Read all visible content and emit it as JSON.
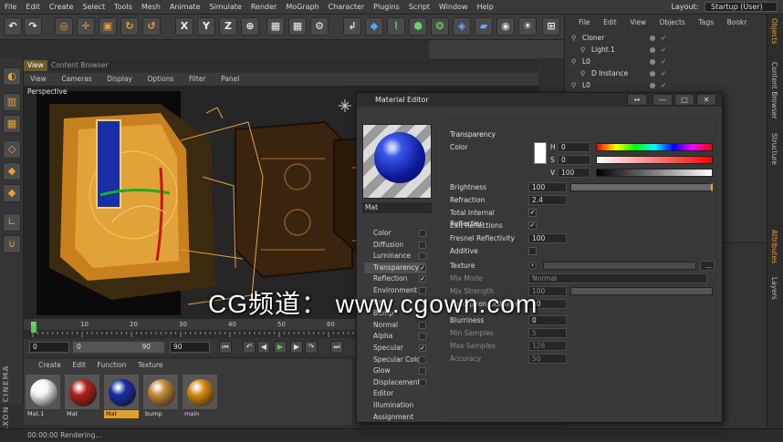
{
  "menubar": {
    "items": [
      "File",
      "Edit",
      "Create",
      "Select",
      "Tools",
      "Mesh",
      "Animate",
      "Simulate",
      "Render",
      "MoGraph",
      "Character",
      "Plugins",
      "Script",
      "Window",
      "Help"
    ],
    "layout_label": "Layout:",
    "layout_value": "Startup (User)"
  },
  "toolbar": {
    "axis_x": "X",
    "axis_y": "Y",
    "axis_z": "Z"
  },
  "view": {
    "tabs": [
      "View",
      "Content Browser"
    ],
    "menu": [
      "View",
      "Cameras",
      "Display",
      "Options",
      "Filter",
      "Panel"
    ],
    "label": "Perspective"
  },
  "timeline": {
    "ticks": [
      "0",
      "10",
      "20",
      "30",
      "40",
      "50",
      "60"
    ],
    "start": "0",
    "current": "0",
    "end_slider": "90",
    "end": "90"
  },
  "material_manager": {
    "menu": [
      "Create",
      "Edit",
      "Function",
      "Texture"
    ],
    "materials": [
      {
        "name": "Mat.1",
        "color": "#f5f5f5"
      },
      {
        "name": "Mat",
        "color": "#b3231a"
      },
      {
        "name": "Mat",
        "color": "#1a2ea8"
      },
      {
        "name": "bump",
        "color": "#c58a3a"
      },
      {
        "name": "main",
        "color": "#d88a10"
      }
    ]
  },
  "status": {
    "text": "00:00:00 Rendering..."
  },
  "brand": "MAXON CINEMA 4D",
  "object_manager": {
    "menu": [
      "File",
      "Edit",
      "View",
      "Objects",
      "Tags",
      "Bookr"
    ],
    "objects": [
      {
        "name": "Cloner",
        "indent": 0
      },
      {
        "name": "Light.1",
        "indent": 1
      },
      {
        "name": "L0",
        "indent": 0
      },
      {
        "name": "D Instance",
        "indent": 1
      },
      {
        "name": "L0",
        "indent": 0
      }
    ],
    "side_tabs": [
      "Objects",
      "Content Browser",
      "Structure",
      "Attributes",
      "Layers"
    ]
  },
  "material_editor": {
    "title": "Material Editor",
    "mat_name": "Mat",
    "channels": [
      {
        "label": "Color",
        "checked": false
      },
      {
        "label": "Diffusion",
        "checked": false
      },
      {
        "label": "Luminance",
        "checked": false
      },
      {
        "label": "Transparency",
        "checked": true
      },
      {
        "label": "Reflection",
        "checked": true
      },
      {
        "label": "Environment",
        "checked": false
      },
      {
        "label": "Fog",
        "checked": false
      },
      {
        "label": "Bump",
        "checked": false
      },
      {
        "label": "Normal",
        "checked": false
      },
      {
        "label": "Alpha",
        "checked": false
      },
      {
        "label": "Specular",
        "checked": true
      },
      {
        "label": "Specular Color",
        "checked": false
      },
      {
        "label": "Glow",
        "checked": false
      },
      {
        "label": "Displacement",
        "checked": false
      },
      {
        "label": "Editor",
        "checked": false
      },
      {
        "label": "Illumination",
        "checked": false
      },
      {
        "label": "Assignment",
        "checked": false
      }
    ],
    "section": "Transparency",
    "color_label": "Color",
    "hsv": [
      {
        "ch": "H",
        "val": "0"
      },
      {
        "ch": "S",
        "val": "0"
      },
      {
        "ch": "V",
        "val": "100"
      }
    ],
    "params": [
      {
        "label": "Brightness",
        "value": "100",
        "type": "slider",
        "fill": 1.0
      },
      {
        "label": "Refraction",
        "value": "2.4",
        "type": "value"
      },
      {
        "label": "Total Internal Reflection",
        "type": "check",
        "checked": true
      },
      {
        "label": "Exit Reflections",
        "type": "check",
        "checked": true
      },
      {
        "label": "Fresnel Reflectivity",
        "value": "100",
        "type": "value"
      },
      {
        "label": "Additive",
        "type": "check",
        "checked": false
      }
    ],
    "texture_label": "Texture",
    "mix_mode_label": "Mix Mode",
    "mix_mode_value": "Normal",
    "mix_strength_label": "Mix Strength",
    "mix_strength_value": "100",
    "absorption_label": "Absorption Distance",
    "absorption_value": "10",
    "blur": [
      {
        "label": "Blurriness",
        "value": "0",
        "dim": false
      },
      {
        "label": "Min Samples",
        "value": "5",
        "dim": true
      },
      {
        "label": "Max Samples",
        "value": "128",
        "dim": true
      },
      {
        "label": "Accuracy",
        "value": "50",
        "dim": true
      }
    ]
  },
  "watermark": "CG频道： www.cgown.com"
}
